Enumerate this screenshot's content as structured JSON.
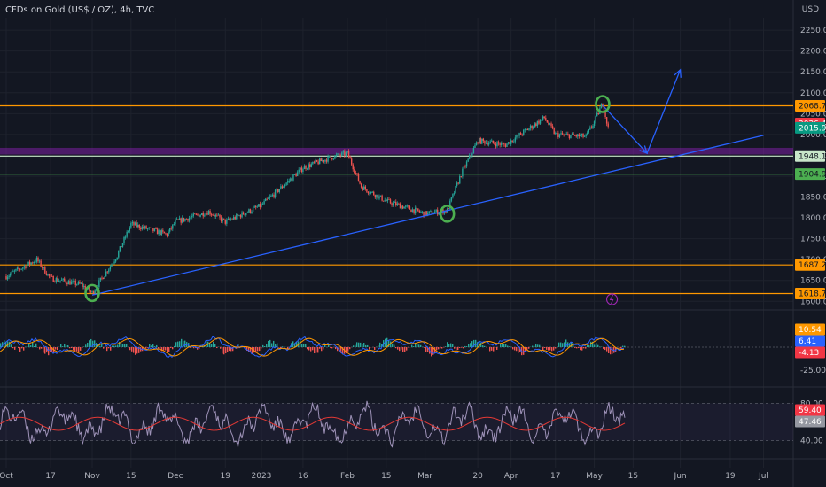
{
  "header": {
    "title": "CFDs on Gold (US$ / OZ), 4h, TVC",
    "currency": "USD"
  },
  "colors": {
    "background": "#131722",
    "grid": "#1e222d",
    "candle_up": "#26a69a",
    "candle_down": "#ef5350",
    "orange_level": "#ff9800",
    "green_level": "#4caf50",
    "purple_zone": "#7b1fa2",
    "trendline": "#2962ff",
    "circle": "#4caf50"
  },
  "chart_data": {
    "type": "candlestick",
    "symbol": "CFDs on Gold (US$ / OZ)",
    "timeframe": "4h",
    "x_ticks": [
      "Oct",
      "17",
      "Nov",
      "15",
      "Dec",
      "19",
      "2023",
      "16",
      "Feb",
      "15",
      "Mar",
      "20",
      "Apr",
      "17",
      "May",
      "15",
      "Jun",
      "19",
      "Jul"
    ],
    "y_ticks": [
      "2250.00",
      "2200.00",
      "2150.00",
      "2100.00",
      "2050.00",
      "2000.00",
      "1950.00",
      "1900.00",
      "1850.00",
      "1800.00",
      "1750.00",
      "1700.00",
      "1650.00",
      "1600.00"
    ],
    "ylim": [
      1590,
      2280
    ],
    "price_path": [
      {
        "t": "Oct",
        "p": 1660
      },
      {
        "t": "Oct 12",
        "p": 1700
      },
      {
        "t": "Oct 17",
        "p": 1655
      },
      {
        "t": "Oct 28",
        "p": 1640
      },
      {
        "t": "Nov",
        "p": 1620
      },
      {
        "t": "Nov 10",
        "p": 1710
      },
      {
        "t": "Nov 15",
        "p": 1785
      },
      {
        "t": "Nov 28",
        "p": 1760
      },
      {
        "t": "Dec",
        "p": 1790
      },
      {
        "t": "Dec 13",
        "p": 1815
      },
      {
        "t": "Dec 19",
        "p": 1790
      },
      {
        "t": "2023",
        "p": 1830
      },
      {
        "t": "Jan 16",
        "p": 1920
      },
      {
        "t": "Jan 26",
        "p": 1945
      },
      {
        "t": "Feb",
        "p": 1955
      },
      {
        "t": "Feb 6",
        "p": 1875
      },
      {
        "t": "Feb 15",
        "p": 1840
      },
      {
        "t": "Mar",
        "p": 1810
      },
      {
        "t": "Mar 9",
        "p": 1818
      },
      {
        "t": "Mar 14",
        "p": 1905
      },
      {
        "t": "Mar 20",
        "p": 1985
      },
      {
        "t": "Mar 30",
        "p": 1975
      },
      {
        "t": "Apr",
        "p": 1985
      },
      {
        "t": "Apr 13",
        "p": 2040
      },
      {
        "t": "Apr 17",
        "p": 2000
      },
      {
        "t": "Apr 28",
        "p": 1995
      },
      {
        "t": "May",
        "p": 2030
      },
      {
        "t": "May 4",
        "p": 2075
      },
      {
        "t": "May 6",
        "p": 2015
      }
    ],
    "price_labels": [
      {
        "value": "2068.77",
        "price": 2068.77,
        "color": "#ff9800",
        "text_color": "#131722"
      },
      {
        "value": "2026.40",
        "price": 2026.4,
        "color": "#f23645",
        "text_color": "#ffffff"
      },
      {
        "value": "2015.94",
        "price": 2015.94,
        "color": "#089981",
        "text_color": "#ffffff"
      },
      {
        "value": "1948.17",
        "price": 1948.17,
        "color": "#c8e6c9",
        "text_color": "#131722"
      },
      {
        "value": "1904.92",
        "price": 1904.92,
        "color": "#4caf50",
        "text_color": "#131722"
      },
      {
        "value": "1687.22",
        "price": 1687.22,
        "color": "#ff9800",
        "text_color": "#131722"
      },
      {
        "value": "1618.74",
        "price": 1618.74,
        "color": "#ff9800",
        "text_color": "#131722"
      }
    ],
    "horizontal_levels": [
      {
        "price": 2068.77,
        "color": "#ff9800"
      },
      {
        "price": 1948.17,
        "color": "#c8e6c9"
      },
      {
        "price": 1904.92,
        "color": "#4caf50"
      },
      {
        "price": 1687.22,
        "color": "#ff9800"
      },
      {
        "price": 1618.74,
        "color": "#ff9800"
      }
    ],
    "zone": {
      "from": 1952,
      "to": 1968,
      "color": "#7b1fa2"
    },
    "trendline": {
      "from": {
        "t": "Nov",
        "p": 1615
      },
      "to": {
        "t": "Jul",
        "p": 1998
      }
    },
    "projection": [
      {
        "t": "May 4",
        "p": 2070
      },
      {
        "t": "May 20",
        "p": 1955
      },
      {
        "t": "Jun",
        "p": 2155
      }
    ],
    "circles": [
      {
        "t": "Nov",
        "p": 1620
      },
      {
        "t": "Mar 9",
        "p": 1810
      },
      {
        "t": "May 4",
        "p": 2073
      }
    ],
    "indicator_macd": {
      "y_ticks": [
        "-25.00"
      ],
      "labels": [
        {
          "value": "10.54",
          "color": "#ff9800"
        },
        {
          "value": "6.41",
          "color": "#2962ff"
        },
        {
          "value": "-4.13",
          "color": "#f23645"
        }
      ]
    },
    "indicator_rsi": {
      "y_ticks": [
        "80.00",
        "40.00"
      ],
      "labels": [
        {
          "value": "59.40",
          "color": "#f23645"
        },
        {
          "value": "47.46",
          "color": "#9598a1"
        }
      ]
    }
  }
}
